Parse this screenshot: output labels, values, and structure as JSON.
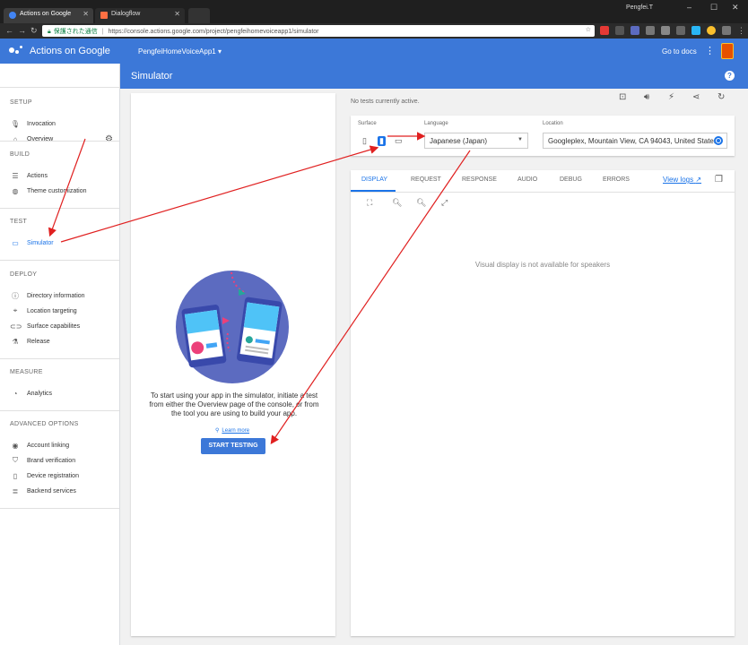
{
  "browser": {
    "tabs": [
      {
        "label": "Actions on Google",
        "active": true
      },
      {
        "label": "Dialogflow",
        "active": false
      }
    ],
    "profile_name": "Pengfei.T",
    "security_label": "保護された通信",
    "url": "https://console.actions.google.com/project/pengfeihomevoiceapp1/simulator"
  },
  "app": {
    "title": "Actions on Google",
    "project": "PengfeiHomeVoiceApp1",
    "go_to_docs": "Go to docs"
  },
  "sidebar": {
    "overview": "Overview",
    "sections": [
      {
        "heading": "SETUP",
        "items": [
          {
            "label": "Invocation",
            "icon": "mic-icon"
          }
        ]
      },
      {
        "heading": "BUILD",
        "items": [
          {
            "label": "Actions",
            "icon": "list-icon"
          },
          {
            "label": "Theme customization",
            "icon": "palette-icon"
          }
        ]
      },
      {
        "heading": "TEST",
        "items": [
          {
            "label": "Simulator",
            "icon": "devices-icon",
            "active": true
          }
        ]
      },
      {
        "heading": "DEPLOY",
        "items": [
          {
            "label": "Directory information",
            "icon": "info-icon"
          },
          {
            "label": "Location targeting",
            "icon": "location-icon"
          },
          {
            "label": "Surface capabilites",
            "icon": "toggle-icon"
          },
          {
            "label": "Release",
            "icon": "flask-icon"
          }
        ]
      },
      {
        "heading": "MEASURE",
        "items": [
          {
            "label": "Analytics",
            "icon": "analytics-icon"
          }
        ]
      },
      {
        "heading": "ADVANCED OPTIONS",
        "items": [
          {
            "label": "Account linking",
            "icon": "account-icon"
          },
          {
            "label": "Brand verification",
            "icon": "shield-icon"
          },
          {
            "label": "Device registration",
            "icon": "device-icon"
          },
          {
            "label": "Backend services",
            "icon": "services-icon"
          }
        ]
      }
    ]
  },
  "simulator": {
    "title": "Simulator",
    "intro": "To start using your app in the simulator, initiate a test from either the Overview page of the console, or from the tool you are using to build your app.",
    "learn_more": "Learn more",
    "start_button": "START TESTING",
    "status": "No tests currently active."
  },
  "settings": {
    "surface_label": "Surface",
    "language_label": "Language",
    "language_value": "Japanese (Japan)",
    "location_label": "Location",
    "location_value": "Googleplex, Mountain View, CA 94043, United States"
  },
  "display": {
    "tabs": [
      "DISPLAY",
      "REQUEST",
      "RESPONSE",
      "AUDIO",
      "DEBUG",
      "ERRORS"
    ],
    "active_tab": "DISPLAY",
    "view_logs": "View logs",
    "message": "Visual display is not available for speakers"
  },
  "colors": {
    "header_blue": "#3c78d8",
    "accent_blue": "#1a73e8",
    "annotation_red": "#e02020"
  }
}
